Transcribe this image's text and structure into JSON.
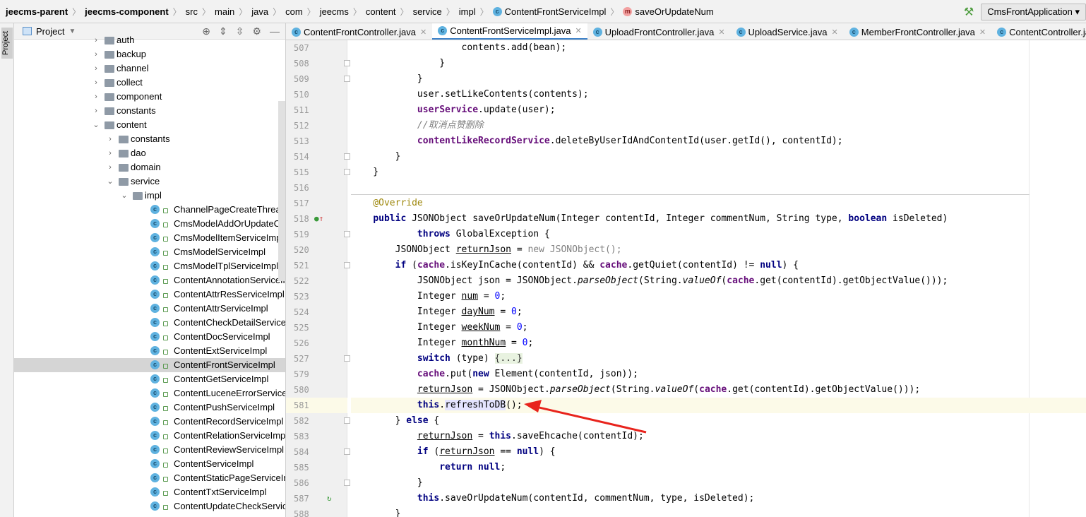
{
  "breadcrumb": [
    "jeecms-parent",
    "jeecms-component",
    "src",
    "main",
    "java",
    "com",
    "jeecms",
    "content",
    "service",
    "impl",
    "ContentFrontServiceImpl",
    "saveOrUpdateNum"
  ],
  "run_config": "CmsFrontApplication",
  "strip_label": "Project",
  "sidebar": {
    "title": "Project",
    "items": [
      {
        "label": "auth",
        "level": 1,
        "type": "folder"
      },
      {
        "label": "backup",
        "level": 1,
        "type": "folder"
      },
      {
        "label": "channel",
        "level": 1,
        "type": "folder"
      },
      {
        "label": "collect",
        "level": 1,
        "type": "folder"
      },
      {
        "label": "component",
        "level": 1,
        "type": "folder"
      },
      {
        "label": "constants",
        "level": 1,
        "type": "folder"
      },
      {
        "label": "content",
        "level": 1,
        "type": "folder",
        "open": true
      },
      {
        "label": "constants",
        "level": 2,
        "type": "folder"
      },
      {
        "label": "dao",
        "level": 2,
        "type": "folder"
      },
      {
        "label": "domain",
        "level": 2,
        "type": "folder"
      },
      {
        "label": "service",
        "level": 2,
        "type": "folder",
        "open": true
      },
      {
        "label": "impl",
        "level": 3,
        "type": "folder",
        "open": true
      },
      {
        "label": "ChannelPageCreateThreadS",
        "level": 4,
        "type": "class"
      },
      {
        "label": "CmsModelAddOrUpdateCo",
        "level": 4,
        "type": "class"
      },
      {
        "label": "CmsModelItemServiceImpl",
        "level": 4,
        "type": "class"
      },
      {
        "label": "CmsModelServiceImpl",
        "level": 4,
        "type": "class"
      },
      {
        "label": "CmsModelTplServiceImpl",
        "level": 4,
        "type": "class"
      },
      {
        "label": "ContentAnnotationServiceIm",
        "level": 4,
        "type": "class"
      },
      {
        "label": "ContentAttrResServiceImpl",
        "level": 4,
        "type": "class"
      },
      {
        "label": "ContentAttrServiceImpl",
        "level": 4,
        "type": "class"
      },
      {
        "label": "ContentCheckDetailServiceI",
        "level": 4,
        "type": "class"
      },
      {
        "label": "ContentDocServiceImpl",
        "level": 4,
        "type": "class"
      },
      {
        "label": "ContentExtServiceImpl",
        "level": 4,
        "type": "class"
      },
      {
        "label": "ContentFrontServiceImpl",
        "level": 4,
        "type": "class",
        "selected": true
      },
      {
        "label": "ContentGetServiceImpl",
        "level": 4,
        "type": "class"
      },
      {
        "label": "ContentLuceneErrorService",
        "level": 4,
        "type": "class"
      },
      {
        "label": "ContentPushServiceImpl",
        "level": 4,
        "type": "class"
      },
      {
        "label": "ContentRecordServiceImpl",
        "level": 4,
        "type": "class"
      },
      {
        "label": "ContentRelationServiceImpl",
        "level": 4,
        "type": "class"
      },
      {
        "label": "ContentReviewServiceImpl",
        "level": 4,
        "type": "class"
      },
      {
        "label": "ContentServiceImpl",
        "level": 4,
        "type": "class"
      },
      {
        "label": "ContentStaticPageServiceIm",
        "level": 4,
        "type": "class"
      },
      {
        "label": "ContentTxtServiceImpl",
        "level": 4,
        "type": "class"
      },
      {
        "label": "ContentUpdateCheckServic",
        "level": 4,
        "type": "class"
      }
    ]
  },
  "tabs": [
    {
      "label": "ContentFrontController.java"
    },
    {
      "label": "ContentFrontServiceImpl.java",
      "active": true
    },
    {
      "label": "UploadFrontController.java"
    },
    {
      "label": "UploadService.java"
    },
    {
      "label": "MemberFrontController.java"
    },
    {
      "label": "ContentController.java"
    }
  ],
  "code": [
    {
      "n": "507",
      "t": [
        [
          "                    contents.add(bean);",
          ""
        ]
      ]
    },
    {
      "n": "508",
      "t": [
        [
          "                }",
          ""
        ]
      ]
    },
    {
      "n": "509",
      "t": [
        [
          "            }",
          ""
        ]
      ]
    },
    {
      "n": "510",
      "t": [
        [
          "            user.setLikeContents(contents);",
          ""
        ]
      ]
    },
    {
      "n": "511",
      "t": [
        [
          "            ",
          ""
        ],
        [
          "userService",
          "fd"
        ],
        [
          ".update(user);",
          ""
        ]
      ]
    },
    {
      "n": "512",
      "t": [
        [
          "            //取消点赞删除",
          "cm"
        ]
      ]
    },
    {
      "n": "513",
      "t": [
        [
          "            ",
          ""
        ],
        [
          "contentLikeRecordService",
          "fd"
        ],
        [
          ".deleteByUserIdAndContentId(user.getId(), contentId);",
          ""
        ]
      ]
    },
    {
      "n": "514",
      "t": [
        [
          "        }",
          ""
        ]
      ]
    },
    {
      "n": "515",
      "t": [
        [
          "    }",
          ""
        ]
      ]
    },
    {
      "n": "516",
      "t": []
    },
    {
      "n": "517",
      "t": [
        [
          "    @Override",
          "an"
        ]
      ]
    },
    {
      "n": "518",
      "t": [
        [
          "    ",
          ""
        ],
        [
          "public",
          "kw"
        ],
        [
          " JSONObject saveOrUpdateNum(Integer contentId, Integer commentNum, String type, ",
          ""
        ],
        [
          "boolean",
          "kw"
        ],
        [
          " isDeleted)",
          ""
        ]
      ]
    },
    {
      "n": "519",
      "t": [
        [
          "            ",
          ""
        ],
        [
          "throws",
          "kw"
        ],
        [
          " GlobalException {",
          ""
        ]
      ]
    },
    {
      "n": "520",
      "t": [
        [
          "        JSONObject ",
          ""
        ],
        [
          "returnJson",
          "ul"
        ],
        [
          " = ",
          ""
        ],
        [
          "new JSONObject();",
          "gr"
        ]
      ]
    },
    {
      "n": "521",
      "t": [
        [
          "        ",
          ""
        ],
        [
          "if",
          "kw"
        ],
        [
          " (",
          ""
        ],
        [
          "cache",
          "fd"
        ],
        [
          ".isKeyInCache(contentId) && ",
          ""
        ],
        [
          "cache",
          "fd"
        ],
        [
          ".getQuiet(contentId) != ",
          ""
        ],
        [
          "null",
          "kw"
        ],
        [
          ") {",
          ""
        ]
      ]
    },
    {
      "n": "522",
      "t": [
        [
          "            JSONObject json = JSONObject.",
          ""
        ],
        [
          "parseObject",
          "it"
        ],
        [
          "(String.",
          ""
        ],
        [
          "valueOf",
          "it"
        ],
        [
          "(",
          ""
        ],
        [
          "cache",
          "fd"
        ],
        [
          ".get(contentId).getObjectValue()));",
          ""
        ]
      ]
    },
    {
      "n": "523",
      "t": [
        [
          "            Integer ",
          ""
        ],
        [
          "num",
          "ul"
        ],
        [
          " = ",
          ""
        ],
        [
          "0",
          "nm"
        ],
        [
          ";",
          ""
        ]
      ]
    },
    {
      "n": "524",
      "t": [
        [
          "            Integer ",
          ""
        ],
        [
          "dayNum",
          "ul"
        ],
        [
          " = ",
          ""
        ],
        [
          "0",
          "nm"
        ],
        [
          ";",
          ""
        ]
      ]
    },
    {
      "n": "525",
      "t": [
        [
          "            Integer ",
          ""
        ],
        [
          "weekNum",
          "ul"
        ],
        [
          " = ",
          ""
        ],
        [
          "0",
          "nm"
        ],
        [
          ";",
          ""
        ]
      ]
    },
    {
      "n": "526",
      "t": [
        [
          "            Integer ",
          ""
        ],
        [
          "monthNum",
          "ul"
        ],
        [
          " = ",
          ""
        ],
        [
          "0",
          "nm"
        ],
        [
          ";",
          ""
        ]
      ]
    },
    {
      "n": "527",
      "t": [
        [
          "            ",
          ""
        ],
        [
          "switch",
          "kw"
        ],
        [
          " (type) ",
          ""
        ],
        [
          "{...}",
          "fb"
        ]
      ]
    },
    {
      "n": "579",
      "t": [
        [
          "            ",
          ""
        ],
        [
          "cache",
          "fd"
        ],
        [
          ".put(",
          ""
        ],
        [
          "new",
          "kw"
        ],
        [
          " Element(contentId, json));",
          ""
        ]
      ]
    },
    {
      "n": "580",
      "t": [
        [
          "            ",
          ""
        ],
        [
          "returnJson",
          "ul"
        ],
        [
          " = JSONObject.",
          ""
        ],
        [
          "parseObject",
          "it"
        ],
        [
          "(String.",
          ""
        ],
        [
          "valueOf",
          "it"
        ],
        [
          "(",
          ""
        ],
        [
          "cache",
          "fd"
        ],
        [
          ".get(contentId).getObjectValue()));",
          ""
        ]
      ]
    },
    {
      "n": "581",
      "t": [
        [
          "            ",
          ""
        ],
        [
          "this",
          "kw"
        ],
        [
          ".",
          ""
        ],
        [
          "refreshToDB",
          "hl"
        ],
        [
          "();",
          ""
        ]
      ],
      "current": true
    },
    {
      "n": "582",
      "t": [
        [
          "        } ",
          ""
        ],
        [
          "else",
          "kw"
        ],
        [
          " {",
          ""
        ]
      ]
    },
    {
      "n": "583",
      "t": [
        [
          "            ",
          ""
        ],
        [
          "returnJson",
          "ul"
        ],
        [
          " = ",
          ""
        ],
        [
          "this",
          "kw"
        ],
        [
          ".saveEhcache(contentId);",
          ""
        ]
      ]
    },
    {
      "n": "584",
      "t": [
        [
          "            ",
          ""
        ],
        [
          "if",
          "kw"
        ],
        [
          " (",
          ""
        ],
        [
          "returnJson",
          "ul"
        ],
        [
          " == ",
          ""
        ],
        [
          "null",
          "kw"
        ],
        [
          ") {",
          ""
        ]
      ]
    },
    {
      "n": "585",
      "t": [
        [
          "                ",
          ""
        ],
        [
          "return null",
          "kw"
        ],
        [
          ";",
          ""
        ]
      ]
    },
    {
      "n": "586",
      "t": [
        [
          "            }",
          ""
        ]
      ]
    },
    {
      "n": "587",
      "t": [
        [
          "            ",
          ""
        ],
        [
          "this",
          "kw"
        ],
        [
          ".saveOrUpdateNum(contentId, commentNum, type, isDeleted);",
          ""
        ]
      ]
    },
    {
      "n": "588",
      "t": [
        [
          "        }",
          ""
        ]
      ]
    }
  ]
}
